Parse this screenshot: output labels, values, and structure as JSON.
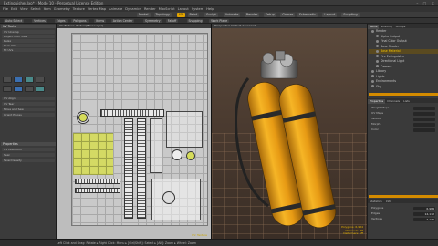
{
  "window": {
    "title": "Extinguisher.lxo* - Modo 10 - Perpetual License Edition",
    "controls": "– □ ✕"
  },
  "menu": [
    "File",
    "Edit",
    "View",
    "Select",
    "Item",
    "Geometry",
    "Texture",
    "Vertex Map",
    "Animate",
    "Dynamics",
    "Render",
    "MaxScript",
    "Layout",
    "System",
    "Help"
  ],
  "layout_tabs": [
    "Model",
    "Topology",
    "UV",
    "Paint",
    "Sculpt",
    "Animate",
    "Render",
    "Setup",
    "Games",
    "Schematic",
    "Layout",
    "Scripting"
  ],
  "layout_active": "UV",
  "toolbar": [
    "Auto Select",
    "Vertices",
    "Edges",
    "Polygons",
    "Items",
    "Action Center",
    "Symmetry",
    "Falloff",
    "Snapping",
    "Work Plane"
  ],
  "left_panel": {
    "header1": "UV Tools",
    "rows": [
      "UV Unwrap",
      "Project from View",
      "Relax",
      "Pack UVs",
      "Fit UVs",
      "UV Align",
      "UV Tear",
      "Move and Sew",
      "Orient Pieces"
    ],
    "header2": "Properties",
    "prop_rows": [
      "UV Distortion",
      "Seal",
      "Texel Density"
    ]
  },
  "uv_view": {
    "header": "UV Texture: Texture(Base Layer)",
    "footer": "UV: Texture"
  },
  "view3d": {
    "header": "Perspective   Default   Advanced",
    "footer_lines": [
      "Polygons: 6,984",
      "Channels: 38",
      "Deformers: off"
    ]
  },
  "right_panel": {
    "tabs1": [
      "Items",
      "Shading",
      "Groups"
    ],
    "tabs1_active": "Items",
    "tree": [
      {
        "label": "Render",
        "hl": false
      },
      {
        "label": "Alpha Output",
        "hl": false
      },
      {
        "label": "Final Color Output",
        "hl": false
      },
      {
        "label": "Base Shader",
        "hl": false
      },
      {
        "label": "Base Material",
        "hl": true
      },
      {
        "label": "Fire Extinguisher",
        "hl": false
      },
      {
        "label": "Directional Light",
        "hl": false
      },
      {
        "label": "Camera",
        "hl": false
      },
      {
        "label": "Library",
        "hl": false
      },
      {
        "label": "Lights",
        "hl": false
      },
      {
        "label": "Environments",
        "hl": false
      },
      {
        "label": "Sky",
        "hl": false
      }
    ],
    "tabs2": [
      "Properties",
      "Channels",
      "Lists"
    ],
    "tabs2_active": "Properties",
    "props": [
      {
        "label": "Weight Maps",
        "value": ""
      },
      {
        "label": "UV Maps",
        "value": ""
      },
      {
        "label": "Texture",
        "value": ""
      },
      {
        "label": "Morph",
        "value": ""
      },
      {
        "label": "Color",
        "value": ""
      }
    ],
    "tabs3": [
      "Statistics",
      "Info"
    ],
    "stats": [
      {
        "label": "Polygons",
        "value": "6,984"
      },
      {
        "label": "Edges",
        "value": "14,112"
      },
      {
        "label": "Vertices",
        "value": "7,130"
      }
    ]
  },
  "status": "Left Click and Drag: Rotate  ▸  Right Click: Menu  ▸  [Ctrl/Shift]: Select  ▸  [Alt]: Zoom  ▸  Wheel: Zoom",
  "colors": {
    "accent": "#e0a300",
    "uv_select": "#d6dc5a",
    "tank": "#f2a81d"
  }
}
